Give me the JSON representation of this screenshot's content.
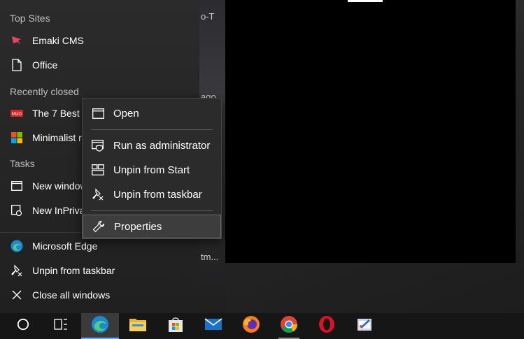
{
  "desktop": {
    "bg_text_1": "o-T",
    "bg_text_2": "ago",
    "bg_text_3": "tm..."
  },
  "jumplist": {
    "top_sites_header": "Top Sites",
    "top_sites": [
      {
        "label": "Emaki CMS",
        "icon": "emaki-cms-icon"
      },
      {
        "label": "Office",
        "icon": "document-icon"
      }
    ],
    "recently_closed_header": "Recently closed",
    "recently_closed": [
      {
        "label": "The 7 Best S",
        "icon": "muo-icon"
      },
      {
        "label": "Minimalist r",
        "icon": "microsoft-icon"
      }
    ],
    "tasks_header": "Tasks",
    "tasks": [
      {
        "label": "New window",
        "icon": "window-icon"
      },
      {
        "label": "New InPrivat",
        "icon": "inprivate-icon"
      }
    ],
    "pinned": [
      {
        "label": "Microsoft Edge",
        "icon": "edge-icon"
      },
      {
        "label": "Unpin from taskbar",
        "icon": "unpin-icon"
      },
      {
        "label": "Close all windows",
        "icon": "close-icon"
      }
    ]
  },
  "context_menu": {
    "items": [
      {
        "label": "Open",
        "icon": "window-icon"
      },
      {
        "label": "Run as administrator",
        "icon": "shield-window-icon"
      },
      {
        "label": "Unpin from Start",
        "icon": "unpin-start-icon"
      },
      {
        "label": "Unpin from taskbar",
        "icon": "unpin-taskbar-icon"
      },
      {
        "label": "Properties",
        "icon": "wrench-icon"
      }
    ]
  },
  "taskbar": {
    "items": [
      "cortana-icon",
      "task-view-icon",
      "edge-icon",
      "file-explorer-icon",
      "microsoft-store-icon",
      "mail-icon",
      "firefox-icon",
      "chrome-icon",
      "opera-icon",
      "paint-icon"
    ]
  },
  "colors": {
    "accent": "#6aa8ff",
    "menu_bg": "#2b2b2b",
    "taskbar_bg": "#161616"
  }
}
